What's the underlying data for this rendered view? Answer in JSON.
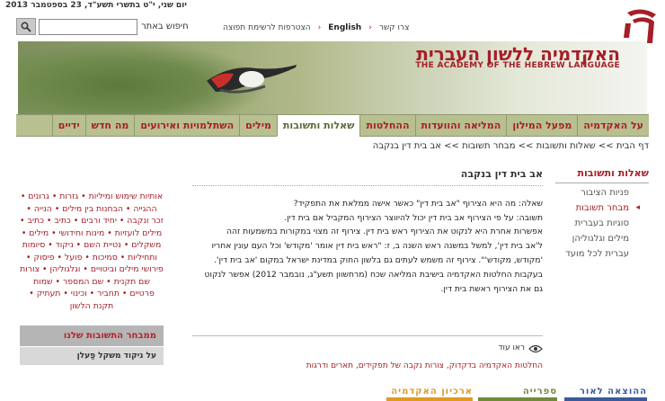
{
  "header": {
    "date": "יום שני, י\"ט בתשרי תשע\"ד, 23 בספטמבר 2013",
    "search_label": "חיפוש באתר",
    "search_value": "",
    "links": [
      "צרו קשר",
      "English",
      "הצטרפות לרשימת תפוצה"
    ],
    "links_sep": "›",
    "logo_he": "האקדמיה ללשון העברית",
    "logo_en": "THE ACADEMY OF THE HEBREW LANGUAGE"
  },
  "nav": [
    "על האקדמיה",
    "מפעל המילון",
    "המליאה והוועדות",
    "ההחלטות",
    "שאלות ותשובות",
    "מילים",
    "השתלמויות ואירועים",
    "מה חדש",
    "ידיים"
  ],
  "nav_active": 4,
  "breadcrumb": "דף הבית >> שאלות ותשובות >> מבחר תשובות >> אב בית דין בנקבה",
  "sidebar": {
    "title": "שאלות ותשובות",
    "items": [
      "פניות הציבור",
      "מבחר תשובות",
      "סוגיות בעברית",
      "מילים וגלגוליהן",
      "עברית לכל מועד"
    ],
    "selected": 1
  },
  "article": {
    "title": "אב בית דין בנקבה",
    "q": "שאלה: מה היא הצירוף \"אב בית דין\" כאשר אישה ממלאת את התפקיד?",
    "a1": "תשובה: על פי הצירוף אב בית דין יכול להיווצר הצירוף המקביל אם בית דין.",
    "a2": "אפשרות אחרת היא לנקוט את הצירוף ראש בית דין. צירוף זה מצוי במקורות במשמעות זהה",
    "a3": "ל'אב בית דין', למשל במשנה ראש השנה ב, ז: \"ראש בית דין אומר 'מקודש' וכל העם עונין אחריו",
    "a4": "'מקודש, מקודש'\". צירוף זה משמש לעתים גם בלשון החוק במדינת ישראל במקום 'אב בית דין'.",
    "a5": "בעקבות החלטות האקדמיה בישיבת המליאה שכח (מרחשוון תשע\"ג, נובמבר 2012) אפשר לנקוט",
    "a6": "גם את הצירוף ראשת בית דין.",
    "see_also_label": "ראו עוד",
    "see_also_links": "החלטות האקדמיה בדקדוק, צורות נקבה של תפקידים, תארים ודרגות"
  },
  "tags": "אותיות שימוש ומיליות • גזרות • גרונים • ההגייה • הבחנות בין מילים • הנייה • זכר ונקבה • יחיד ורבים • כתיב • כתיב • מילים לועזיות • מינות וחידושי • מילים • משקלים • נטיית השם • ניקוד • סיומות ותחיליות • סמיכות • פועל • פיסוק • פירושי מילים וביטויים • וגלגוליהן • צורות שם תקנית • שם המספר • שמות פרטיים • תחביר • וכינוי • תעתיק • תקנת הלשון",
  "box": {
    "title": "ממבחר התשובות שלנו",
    "subtitle": "על ניקוד משקל פַעלן"
  },
  "footer": [
    {
      "label": "ההוצאה לאור",
      "color": "#3a5a9a"
    },
    {
      "label": "ספרייה",
      "color": "#6f8a3c"
    },
    {
      "label": "ארכיון האקדמיה",
      "color": "#e09a20"
    }
  ],
  "colors": {
    "brand": "#a61e27",
    "nav_bg": "#b8c090"
  }
}
